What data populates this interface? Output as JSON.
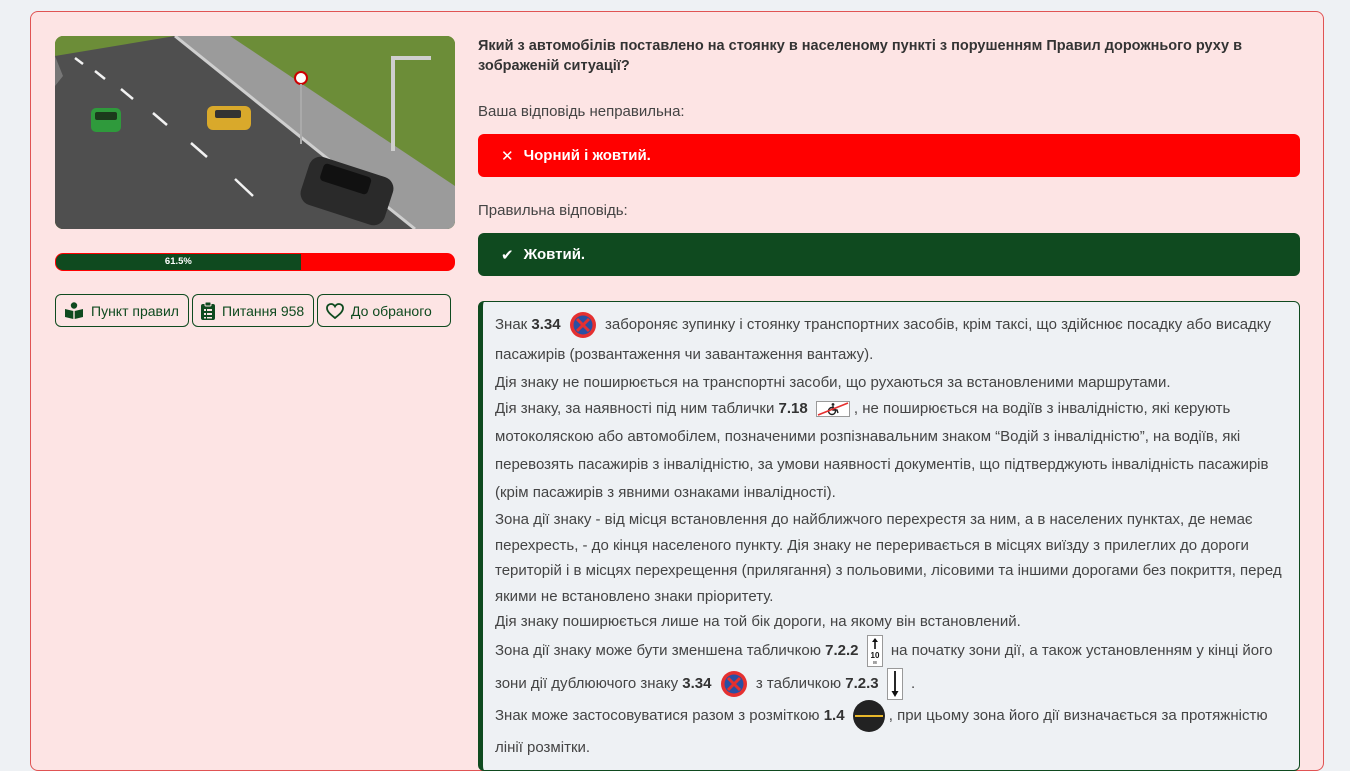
{
  "left": {
    "progress": {
      "percent": 61.5,
      "label": "61.5%"
    },
    "buttons": {
      "rules": "Пункт правил",
      "question": "Питання 958",
      "favorites": "До обраного"
    }
  },
  "question": "Який з автомобілів поставлено на стоянку в населеному пункті з порушенням Правил дорожнього руху в зображеній ситуації?",
  "your_answer": {
    "label": "Ваша відповідь неправильна:",
    "text": "Чорний і жовтий."
  },
  "correct_answer": {
    "label": "Правильна відповідь:",
    "text": "Жовтий."
  },
  "explanation": {
    "p1": {
      "a": "Знак ",
      "sign": "3.34",
      "b": "забороняє зупинку і стоянку транспортних засобів, крім таксі, що здійснює посадку або висадку пасажирів (розвантаження чи завантаження вантажу)."
    },
    "p2": "Дія знаку не поширюється на транспортні засоби, що рухаються за встановленими маршрутами.",
    "p3": {
      "a": "Дія знаку, за наявності під ним таблички ",
      "sign": "7.18",
      "b": ", не поширюється на водіїв з інвалідністю, які керують мотоколяскою або автомобілем, позначеними розпізнавальним знаком “Водій з інвалідністю”, на водіїв, які перевозять пасажирів з інвалідністю, за умови наявності документів, що підтверджують інвалідність пасажирів (крім пасажирів з явними ознаками інвалідності)."
    },
    "p4": "Зона дії знаку - від місця встановлення до найближчого перехрестя за ним, а в населених пунктах, де немає перехресть, - до кінця населеного пункту. Дія знаку не переривається в місцях виїзду з прилеглих до дороги територій і в місцях перехрещення (прилягання) з польовими, лісовими та іншими дорогами без покриття, перед якими не встановлено знаки пріоритету.",
    "p5": "Дія знаку поширюється лише на той бік дороги, на якому він встановлений.",
    "p6": {
      "a": "Зона дії знаку може бути зменшена табличкою ",
      "sign1": "7.2.2",
      "plate_value": "10",
      "plate_unit": "м",
      "b": " на початку зони дії, а також установленням у кінці його зони дії дублюючого знаку ",
      "sign2": "3.34",
      "c": " з табличкою ",
      "sign3": "7.2.3",
      "d": "."
    },
    "p7": {
      "a": "Знак може застосовуватися разом з розміткою ",
      "sign": "1.4",
      "b": ", при цьому зона його дії визначається за протяжністю лінії розмітки."
    }
  },
  "colors": {
    "brand_green": "#0f4a1f",
    "error_red": "#ff0000",
    "card_bg": "#fde4e4"
  }
}
